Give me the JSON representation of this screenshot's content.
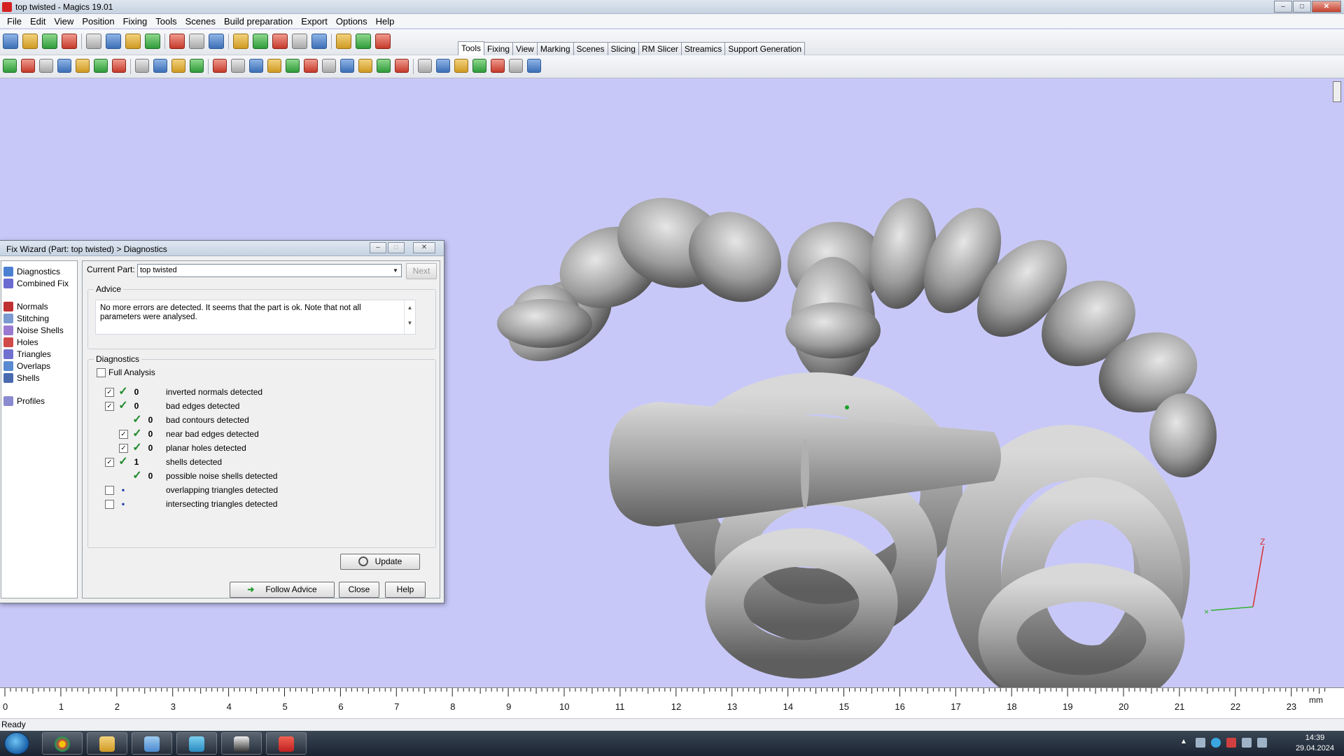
{
  "window": {
    "title": "top twisted - Magics 19.01",
    "min_label": "–",
    "max_label": "□",
    "close_label": "✕"
  },
  "menu": [
    "File",
    "Edit",
    "View",
    "Position",
    "Fixing",
    "Tools",
    "Scenes",
    "Build preparation",
    "Export",
    "Options",
    "Help"
  ],
  "toolbar_tabs": [
    "Tools",
    "Fixing",
    "View",
    "Marking",
    "Scenes",
    "Slicing",
    "RM Slicer",
    "Streamics",
    "Support Generation"
  ],
  "active_tab": "Tools",
  "toolbar1_icons": [
    "new-file-icon",
    "open-folder-icon",
    "save-icon",
    "save-as-icon",
    "import-icon",
    "load-icon",
    "export-icon",
    "delete-part-icon",
    "print-icon",
    "undo-icon",
    "redo-icon",
    "select-icon",
    "rotate-icon",
    "translate-icon",
    "zoom-icon",
    "zoom-fit-icon",
    "checklist-icon",
    "help-icon",
    "wizard-icon"
  ],
  "toolbar2_icons": [
    "translate-part-icon",
    "move-icon",
    "rotate-part-icon",
    "mirror-icon",
    "duplicate-icon",
    "scale-icon",
    "align-icon",
    "cut-icon",
    "punch-icon",
    "hollow-icon",
    "perforate-icon",
    "boolean-icon",
    "shell-icon",
    "offset-icon",
    "extrude-icon",
    "label-icon",
    "smooth-icon",
    "reduce-icon",
    "refine-icon",
    "split-icon",
    "fill-icon",
    "fit-icon",
    "nest-icon",
    "collision-icon",
    "measure-icon",
    "distance-icon",
    "settings-icon",
    "wave-icon",
    "tool-icon"
  ],
  "fix_wizard": {
    "title": "Fix Wizard (Part: top twisted) > Diagnostics",
    "nav": [
      {
        "label": "Diagnostics",
        "icon": "diagnostics-icon"
      },
      {
        "label": "Combined Fix",
        "icon": "combined-fix-icon"
      },
      {
        "label": "Normals",
        "icon": "normals-icon"
      },
      {
        "label": "Stitching",
        "icon": "stitching-icon"
      },
      {
        "label": "Noise Shells",
        "icon": "noise-shells-icon"
      },
      {
        "label": "Holes",
        "icon": "holes-icon"
      },
      {
        "label": "Triangles",
        "icon": "triangles-icon"
      },
      {
        "label": "Overlaps",
        "icon": "overlaps-icon"
      },
      {
        "label": "Shells",
        "icon": "shells-icon"
      },
      {
        "label": "Profiles",
        "icon": "profiles-icon"
      }
    ],
    "current_part_label": "Current Part:",
    "current_part_value": "top twisted",
    "next_label": "Next",
    "advice_label": "Advice",
    "advice_text": "No more errors are detected. It seems that the part is ok. Note that not all parameters were analysed.",
    "diagnostics_label": "Diagnostics",
    "full_analysis_label": "Full Analysis",
    "full_analysis_checked": false,
    "checks": [
      {
        "checked": true,
        "status": "ok",
        "count": "0",
        "text": "inverted normals detected",
        "indent": 0
      },
      {
        "checked": true,
        "status": "ok",
        "count": "0",
        "text": "bad edges detected",
        "indent": 0
      },
      {
        "checked": null,
        "status": "ok",
        "count": "0",
        "text": "bad contours detected",
        "indent": 1
      },
      {
        "checked": true,
        "status": "ok",
        "count": "0",
        "text": "near bad edges detected",
        "indent": 1
      },
      {
        "checked": true,
        "status": "ok",
        "count": "0",
        "text": "planar holes detected",
        "indent": 1
      },
      {
        "checked": true,
        "status": "ok",
        "count": "1",
        "text": "shells detected",
        "indent": 0
      },
      {
        "checked": null,
        "status": "ok",
        "count": "0",
        "text": "possible noise shells detected",
        "indent": 1
      },
      {
        "checked": false,
        "status": "none",
        "count": "",
        "text": "overlapping triangles detected",
        "indent": 0
      },
      {
        "checked": false,
        "status": "none",
        "count": "",
        "text": "intersecting triangles detected",
        "indent": 0
      }
    ],
    "update_label": "Update",
    "follow_advice_label": "Follow Advice",
    "close_label": "Close",
    "help_label": "Help"
  },
  "ruler": {
    "labels": [
      "0",
      "1",
      "2",
      "3",
      "4",
      "5",
      "6",
      "7",
      "8",
      "9",
      "10",
      "11",
      "12",
      "13",
      "14",
      "15",
      "16",
      "17",
      "18",
      "19",
      "20",
      "21",
      "22",
      "23"
    ],
    "unit": "mm"
  },
  "axis_labels": {
    "z": "Z"
  },
  "status": "Ready",
  "taskbar": {
    "apps": [
      "chrome-icon",
      "explorer-icon",
      "paint-icon",
      "v8-icon",
      "inkscape-icon",
      "magics-icon"
    ],
    "time": "14:39",
    "date": "29.04.2024"
  },
  "colors": {
    "viewport_bg": "#c8c8f8",
    "part_color": "#9a9a9a",
    "ok_green": "#1f8a2c"
  }
}
